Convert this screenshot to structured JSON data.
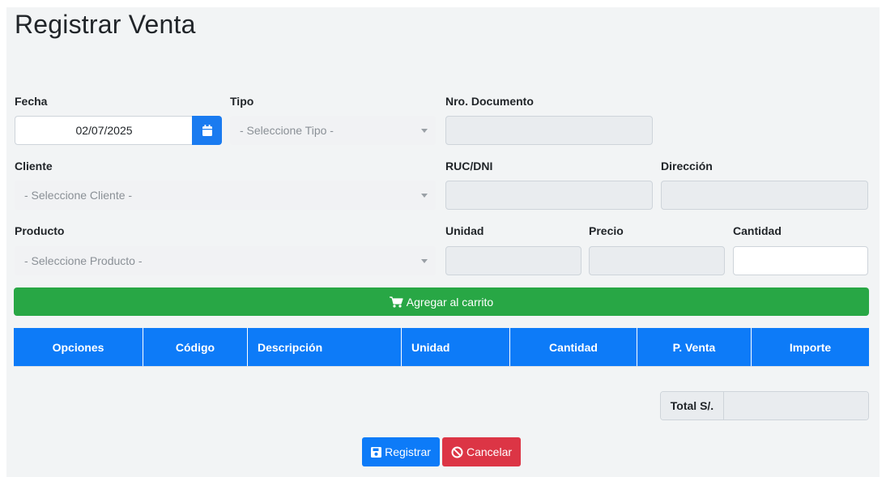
{
  "page": {
    "title": "Registrar Venta"
  },
  "form": {
    "fecha": {
      "label": "Fecha",
      "value": "02/07/2025",
      "icon": "calendar-icon"
    },
    "tipo": {
      "label": "Tipo",
      "placeholder": "- Seleccione Tipo -"
    },
    "nro_documento": {
      "label": "Nro. Documento",
      "value": ""
    },
    "cliente": {
      "label": "Cliente",
      "placeholder": "- Seleccione Cliente -"
    },
    "ruc_dni": {
      "label": "RUC/DNI",
      "value": ""
    },
    "direccion": {
      "label": "Dirección",
      "value": ""
    },
    "producto": {
      "label": "Producto",
      "placeholder": "- Seleccione Producto -"
    },
    "unidad": {
      "label": "Unidad",
      "value": ""
    },
    "precio": {
      "label": "Precio",
      "value": ""
    },
    "cantidad": {
      "label": "Cantidad",
      "value": ""
    }
  },
  "cart": {
    "add_label": "Agregar al carrito",
    "icon": "cart-icon",
    "color": "#28a745"
  },
  "table": {
    "headers": [
      "Opciones",
      "Código",
      "Descripción",
      "Unidad",
      "Cantidad",
      "P. Venta",
      "Importe"
    ],
    "rows": [],
    "header_color": "#0d7bf8"
  },
  "total": {
    "label": "Total S/.",
    "value": ""
  },
  "actions": {
    "register_label": "Registrar",
    "register_icon": "save-icon",
    "cancel_label": "Cancelar",
    "cancel_icon": "ban-icon",
    "primary_color": "#0d7bf8",
    "danger_color": "#dc3545"
  }
}
